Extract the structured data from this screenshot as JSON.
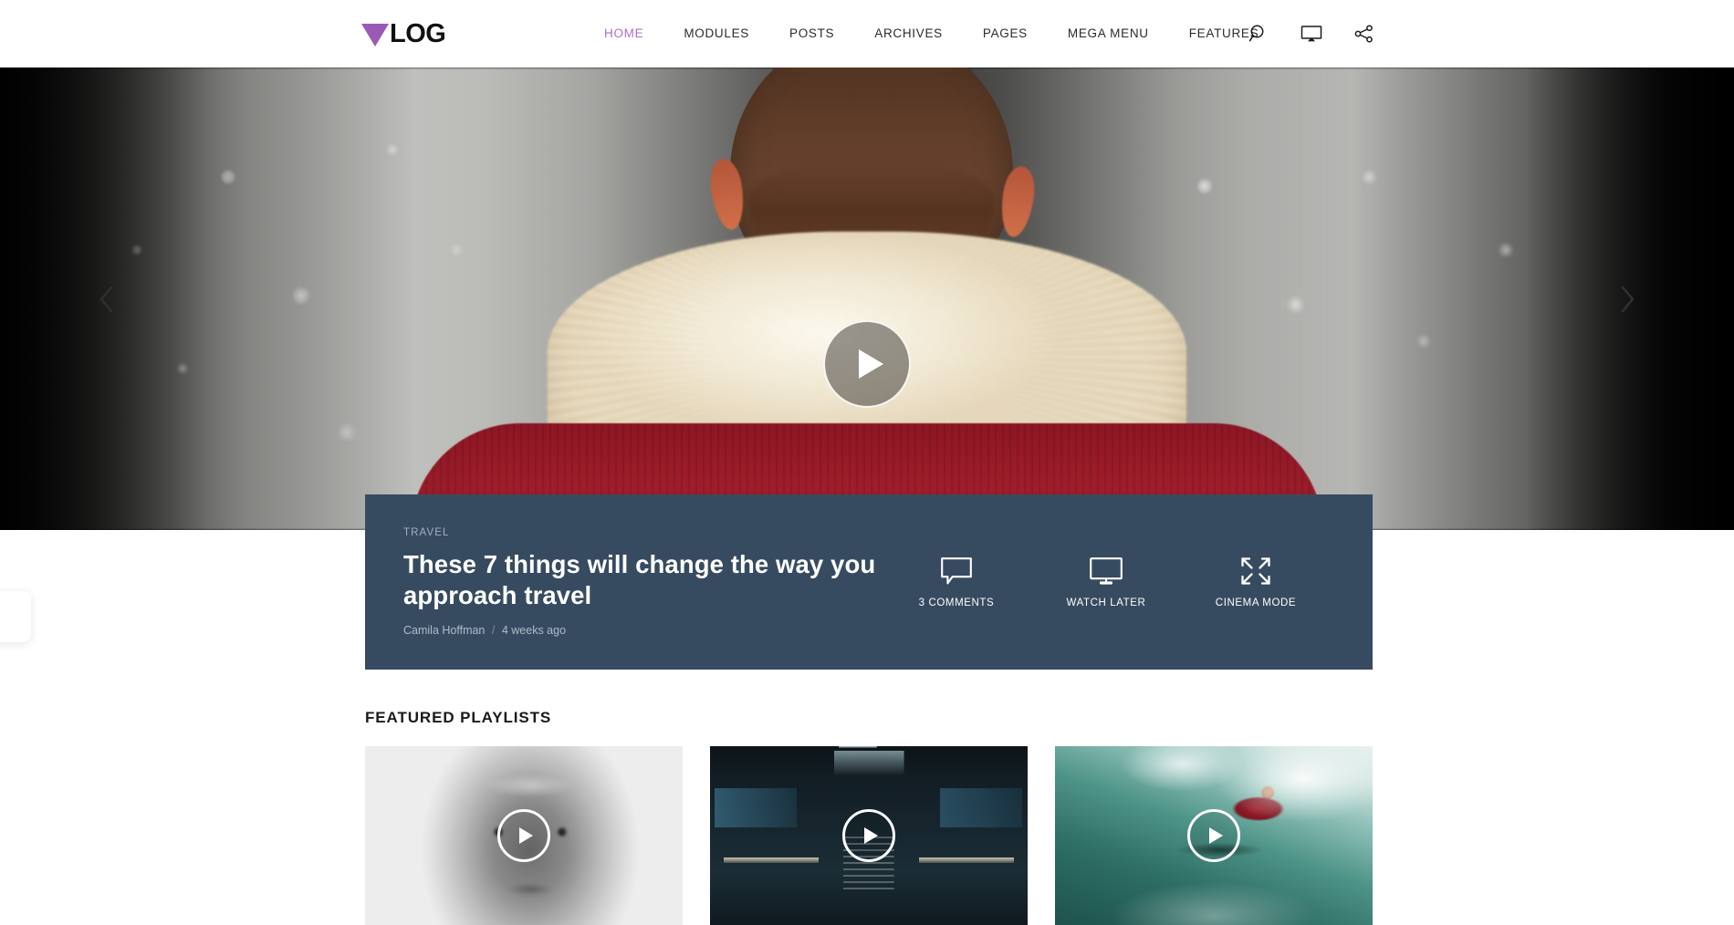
{
  "site": {
    "logo_mark": "triangle-down",
    "logo_text": "LOG",
    "accent_color": "#9b59b6"
  },
  "nav": {
    "items": [
      {
        "label": "HOME",
        "active": true
      },
      {
        "label": "MODULES",
        "active": false
      },
      {
        "label": "POSTS",
        "active": false
      },
      {
        "label": "ARCHIVES",
        "active": false
      },
      {
        "label": "PAGES",
        "active": false
      },
      {
        "label": "MEGA MENU",
        "active": false
      },
      {
        "label": "FEATURES",
        "active": false
      }
    ],
    "icons": [
      {
        "name": "search-icon"
      },
      {
        "name": "monitor-icon"
      },
      {
        "name": "share-icon"
      }
    ]
  },
  "hero": {
    "prev_label": "‹",
    "next_label": "›",
    "play_label": "Play",
    "image_description": "Back of a person's head wearing a crown and white fur collar over a red sweater, bare winter trees behind"
  },
  "featured": {
    "category": "TRAVEL",
    "title": "These 7 things will change the way you approach travel",
    "author": "Camila Hoffman",
    "separator": "/",
    "date": "4 weeks ago",
    "background_color": "#374b60",
    "actions": [
      {
        "icon": "comment-icon",
        "label": "3 COMMENTS"
      },
      {
        "icon": "monitor-icon",
        "label": "WATCH LATER"
      },
      {
        "icon": "expand-icon",
        "label": "CINEMA MODE"
      }
    ]
  },
  "playlists": {
    "section_title": "FEATURED PLAYLISTS",
    "cards": [
      {
        "thumb_class": "thumb-portrait",
        "description": "Black and white close-up portrait of an elderly man"
      },
      {
        "thumb_class": "thumb-terminal",
        "description": "Dark airport terminal with escalator and glass ceiling"
      },
      {
        "thumb_class": "thumb-surf",
        "description": "Surfer in a red shirt riding a teal green wave"
      }
    ]
  }
}
